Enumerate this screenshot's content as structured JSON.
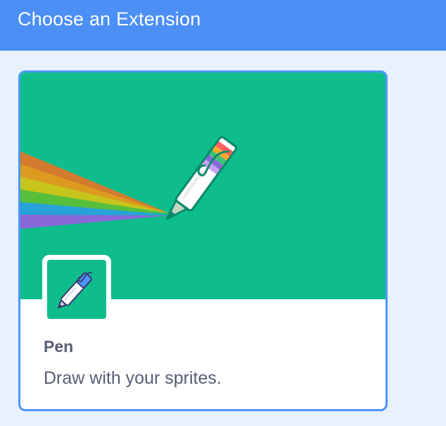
{
  "header": {
    "title": "Choose an Extension",
    "background": "#4c8ff5"
  },
  "extension_card": {
    "title": "Pen",
    "description": "Draw with your sprites.",
    "hero_color": "#0fbd8c",
    "border_color": "#4c97ff",
    "hero_icon": "rainbow-pen-icon",
    "thumb_icon": "pen-icon",
    "selected": false
  },
  "colors": {
    "page_background": "#e9f1fc",
    "text": "#575e75"
  }
}
